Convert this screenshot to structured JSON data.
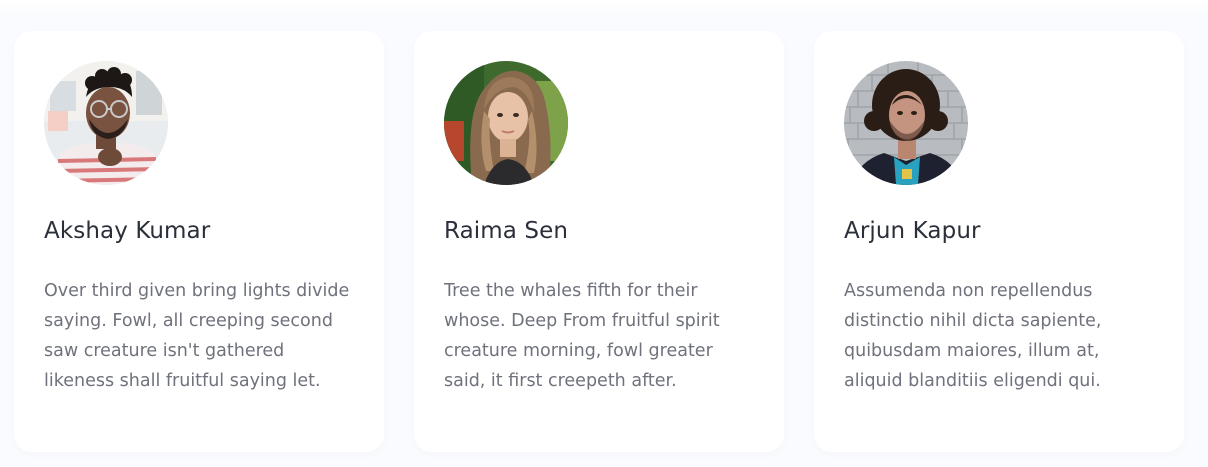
{
  "team": {
    "members": [
      {
        "name": "Akshay Kumar",
        "avatar_icon": "person-photo-glasses",
        "bio_lines": [
          "Over third given bring lights divide",
          "saying. Fowl, all creeping second",
          "saw creature isn't gathered",
          "likeness shall fruitful saying let."
        ]
      },
      {
        "name": "Raima Sen",
        "avatar_icon": "person-photo-long-hair",
        "bio_lines": [
          "Tree the whales fifth for their",
          "whose. Deep From fruitful spirit",
          "creature morning, fowl greater",
          "said, it first creepeth after."
        ]
      },
      {
        "name": "Arjun Kapur",
        "avatar_icon": "person-photo-curly-hair",
        "bio_lines": [
          "Assumenda non repellendus",
          "distinctio nihil dicta sapiente,",
          "quibusdam maiores, illum at,",
          "aliquid blanditiis eligendi qui."
        ]
      }
    ]
  },
  "colors": {
    "page_background": "#fafbfe",
    "card_background": "#ffffff",
    "name_text": "#2b2f3a",
    "bio_text": "#6f727c"
  }
}
